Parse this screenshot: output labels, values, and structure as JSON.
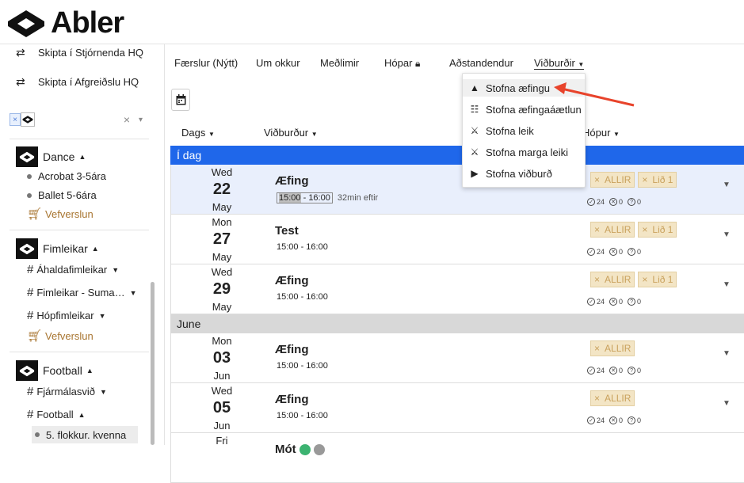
{
  "app": {
    "name": "Abler"
  },
  "sidebar": {
    "switch_items": [
      {
        "label": "Skipta í Stjórnenda HQ"
      },
      {
        "label": "Skipta í Afgreiðslu HQ"
      }
    ],
    "filter": {
      "chip_x": "×",
      "clear": "×",
      "caret": "▾"
    },
    "groups": [
      {
        "name": "Dance",
        "items": [
          {
            "label": "Acrobat 3-5ára",
            "kind": "dot"
          },
          {
            "label": "Ballet 5-6ára",
            "kind": "dot"
          },
          {
            "label": "Vefverslun",
            "kind": "shop"
          }
        ]
      },
      {
        "name": "Fimleikar",
        "items": [
          {
            "label": "Áhaldafimleikar",
            "kind": "hash"
          },
          {
            "label": "Fimleikar - Suma…",
            "kind": "hash"
          },
          {
            "label": "Hópfimleikar",
            "kind": "hash"
          },
          {
            "label": "Vefverslun",
            "kind": "shop"
          }
        ]
      },
      {
        "name": "Football",
        "items": [
          {
            "label": "Fjármálasvið",
            "kind": "hash"
          },
          {
            "label": "Football",
            "kind": "hash"
          },
          {
            "label": "5. flokkur. kvenna",
            "kind": "dot"
          }
        ]
      }
    ]
  },
  "nav": {
    "items": [
      "Færslur (Nýtt)",
      "Um okkur",
      "Meðlimir",
      "Hópar",
      "Aðstandendur",
      "Viðburðir"
    ]
  },
  "columns": {
    "date": "Dags",
    "event": "Viðburður",
    "group": "Hópur"
  },
  "sections": {
    "today": "Í dag",
    "june": "June"
  },
  "events": [
    {
      "dow": "Wed",
      "day": "22",
      "mon": "May",
      "title": "Æfing",
      "start": "15:00",
      "end": "- 16:00",
      "remaining": "32min eftir",
      "badges": [
        "ALLIR",
        "Lið 1"
      ],
      "stats": [
        "24",
        "0",
        "0"
      ]
    },
    {
      "dow": "Mon",
      "day": "27",
      "mon": "May",
      "title": "Test",
      "time": "15:00 - 16:00",
      "badges": [
        "ALLIR",
        "Lið 1"
      ],
      "stats": [
        "24",
        "0",
        "0"
      ]
    },
    {
      "dow": "Wed",
      "day": "29",
      "mon": "May",
      "title": "Æfing",
      "time": "15:00 - 16:00",
      "badges": [
        "ALLIR",
        "Lið 1"
      ],
      "stats": [
        "24",
        "0",
        "0"
      ]
    },
    {
      "dow": "Mon",
      "day": "03",
      "mon": "Jun",
      "title": "Æfing",
      "time": "15:00 - 16:00",
      "badges": [
        "ALLIR"
      ],
      "stats": [
        "24",
        "0",
        "0"
      ]
    },
    {
      "dow": "Wed",
      "day": "05",
      "mon": "Jun",
      "title": "Æfing",
      "time": "15:00 - 16:00",
      "badges": [
        "ALLIR"
      ],
      "stats": [
        "24",
        "0",
        "0"
      ]
    },
    {
      "dow": "Fri",
      "title": "Mót"
    }
  ],
  "dropdown": {
    "items": [
      "Stofna æfingu",
      "Stofna æfingaáætlun",
      "Stofna leik",
      "Stofna marga leiki",
      "Stofna viðburð"
    ]
  },
  "colors": {
    "today_bar": "#1f67ea",
    "badge_bg": "#f3e5c5",
    "arrow": "#e8432b"
  }
}
